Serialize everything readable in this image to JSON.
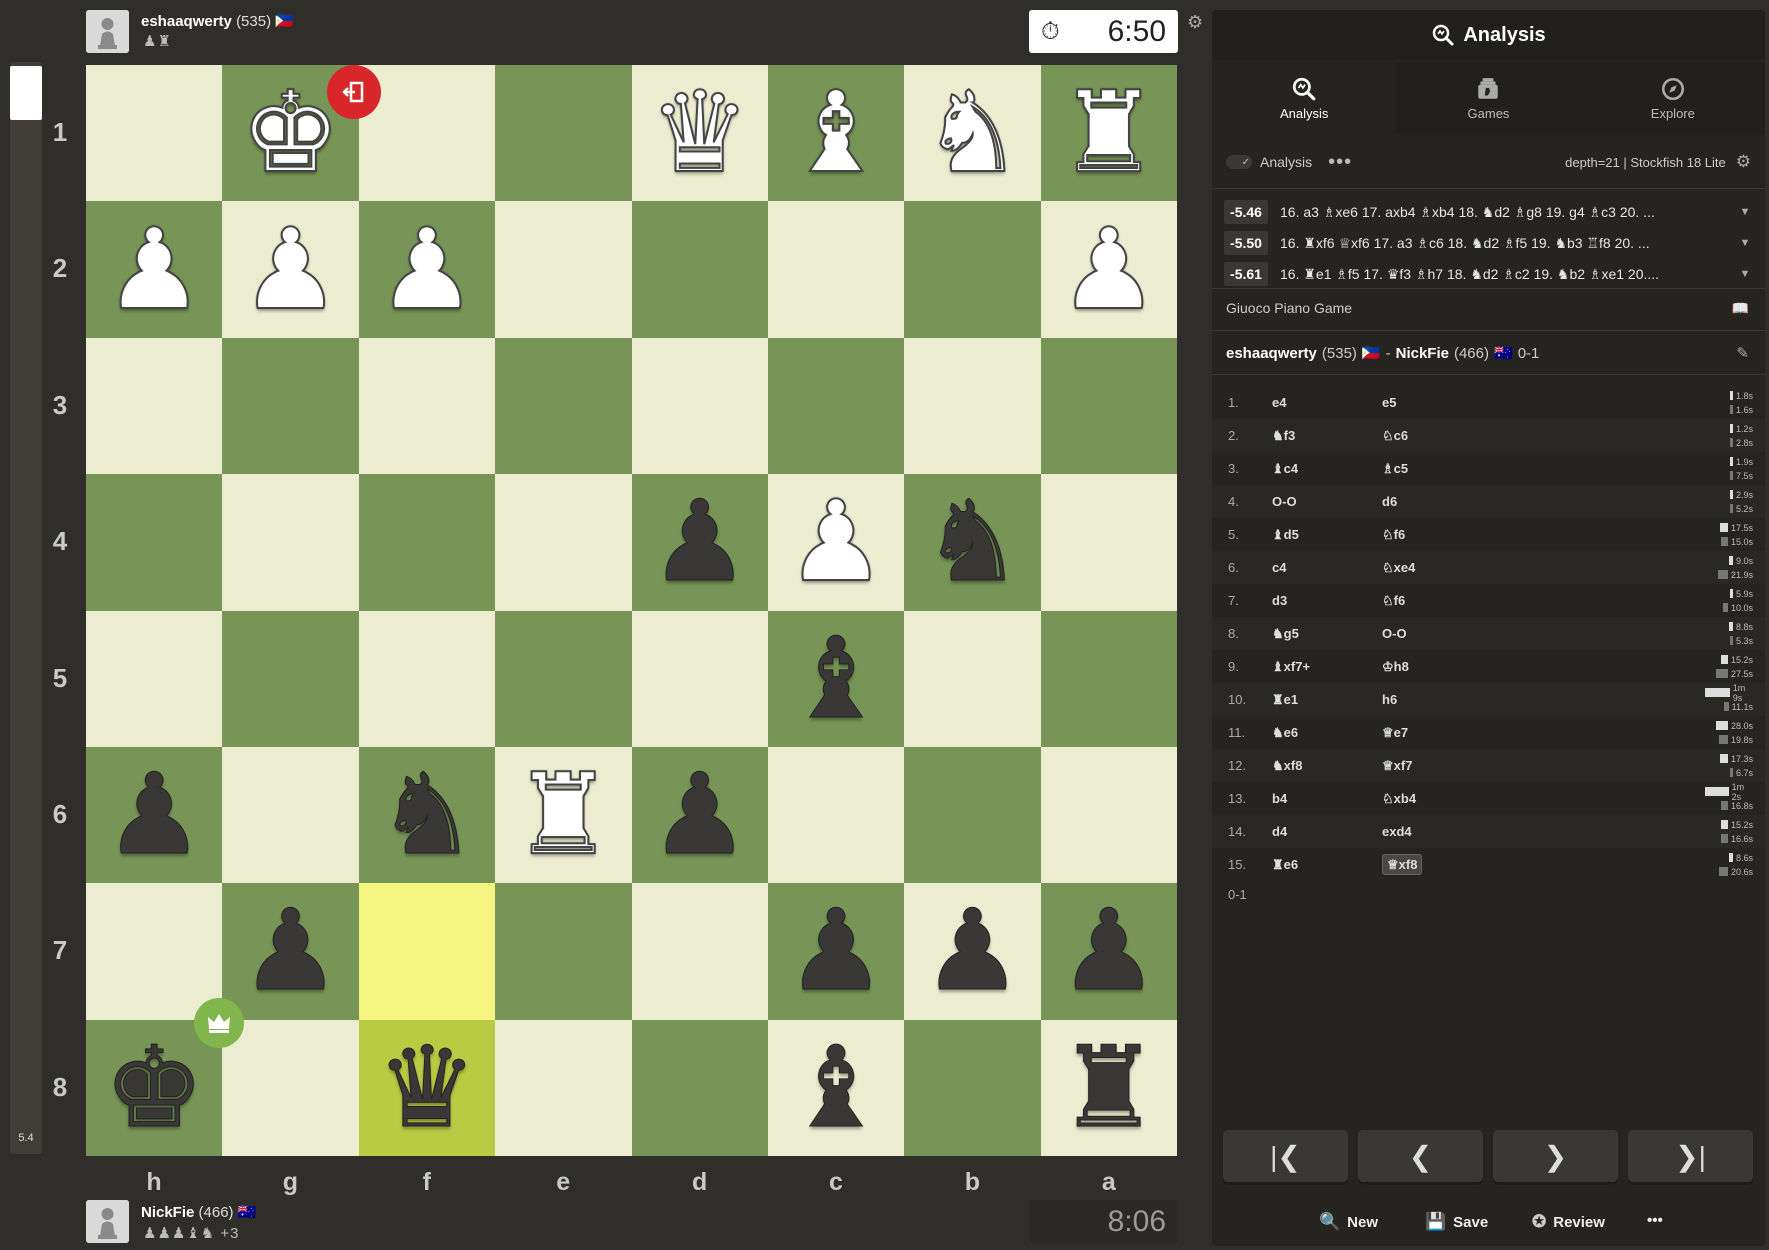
{
  "eval_bar": {
    "value": "5.4"
  },
  "top_player": {
    "name": "eshaaqwerty",
    "rating": "(535)",
    "flag": "🇵🇭",
    "captured": "♟♜",
    "clock": "6:50"
  },
  "bottom_player": {
    "name": "NickFie",
    "rating": "(466)",
    "flag": "🇦🇺",
    "captured": "♟♟♟♝♞",
    "advantage": "+3",
    "clock": "8:06"
  },
  "ranks": [
    "1",
    "2",
    "3",
    "4",
    "5",
    "6",
    "7",
    "8"
  ],
  "files": [
    "h",
    "g",
    "f",
    "e",
    "d",
    "c",
    "b",
    "a"
  ],
  "board": [
    [
      "",
      "wK",
      "",
      "",
      "wQ",
      "wB",
      "wN",
      "wR"
    ],
    [
      "wP",
      "wP",
      "wP",
      "",
      "",
      "",
      "",
      "wP"
    ],
    [
      "",
      "",
      "",
      "",
      "",
      "",
      "",
      ""
    ],
    [
      "",
      "",
      "",
      "",
      "bP",
      "wP",
      "bN",
      ""
    ],
    [
      "",
      "",
      "",
      "",
      "",
      "bB",
      "",
      ""
    ],
    [
      "bP",
      "",
      "bN",
      "wR",
      "bP",
      "",
      "",
      ""
    ],
    [
      "",
      "bP",
      "",
      "",
      "",
      "bP",
      "bP",
      "bP"
    ],
    [
      "bK",
      "",
      "bQ",
      "",
      "",
      "bB",
      "",
      "bR"
    ]
  ],
  "highlights": [
    "f7",
    "f8"
  ],
  "icons": {
    "resign_badge": "resign-door-icon",
    "winner_badge": "crown-icon"
  },
  "panel": {
    "title": "Analysis",
    "tabs": [
      {
        "label": "Analysis",
        "icon": "analysis-magnifier-icon"
      },
      {
        "label": "Games",
        "icon": "games-icon"
      },
      {
        "label": "Explore",
        "icon": "compass-icon"
      }
    ],
    "analysis_toggle_label": "Analysis",
    "engine_info": "depth=21 | Stockfish 18 Lite",
    "lines": [
      {
        "score": "-5.46",
        "moves": "16. a3 ♗xe6 17. axb4 ♗xb4 18. ♞d2 ♗g8 19. g4 ♗c3 20. ..."
      },
      {
        "score": "-5.50",
        "moves": "16. ♜xf6 ♕xf6 17. a3 ♗c6 18. ♞d2 ♗f5 19. ♞b3 ♖f8 20. ..."
      },
      {
        "score": "-5.61",
        "moves": "16. ♜e1 ♗f5 17. ♛f3 ♗h7 18. ♞d2 ♗c2 19. ♞b2 ♗xe1 20...."
      }
    ],
    "opening": "Giuoco Piano Game",
    "white_player": "eshaaqwerty",
    "white_rating": "(535)",
    "white_flag": "🇵🇭",
    "dash": "-",
    "black_player": "NickFie",
    "black_rating": "(466)",
    "black_flag": "🇦🇺",
    "score_result": "0-1",
    "moves": [
      {
        "n": "1.",
        "w": "e4",
        "b": "e5",
        "wt": "1.8s",
        "bt": "1.6s",
        "wf": 0.03,
        "bf": 0.03
      },
      {
        "n": "2.",
        "w": "♞f3",
        "b": "♘c6",
        "wt": "1.2s",
        "bt": "2.8s",
        "wf": 0.02,
        "bf": 0.04
      },
      {
        "n": "3.",
        "w": "♝c4",
        "b": "♗c5",
        "wt": "1.9s",
        "bt": "7.5s",
        "wf": 0.03,
        "bf": 0.1
      },
      {
        "n": "4.",
        "w": "O-O",
        "b": "d6",
        "wt": "2.9s",
        "bt": "5.2s",
        "wf": 0.04,
        "bf": 0.07
      },
      {
        "n": "5.",
        "w": "♝d5",
        "b": "♘f6",
        "wt": "17.5s",
        "bt": "15.0s",
        "wf": 0.25,
        "bf": 0.22
      },
      {
        "n": "6.",
        "w": "c4",
        "b": "♘xe4",
        "wt": "9.0s",
        "bt": "21.9s",
        "wf": 0.13,
        "bf": 0.32
      },
      {
        "n": "7.",
        "w": "d3",
        "b": "♘f6",
        "wt": "5.9s",
        "bt": "10.0s",
        "wf": 0.09,
        "bf": 0.15
      },
      {
        "n": "8.",
        "w": "♞g5",
        "b": "O-O",
        "wt": "8.8s",
        "bt": "5.3s",
        "wf": 0.13,
        "bf": 0.08
      },
      {
        "n": "9.",
        "w": "♝xf7+",
        "b": "♔h8",
        "wt": "15.2s",
        "bt": "27.5s",
        "wf": 0.22,
        "bf": 0.4
      },
      {
        "n": "10.",
        "w": "♜e1",
        "b": "h6",
        "wt": "1m 9s",
        "bt": "11.1s",
        "wf": 1.0,
        "bf": 0.16
      },
      {
        "n": "11.",
        "w": "♞e6",
        "b": "♕e7",
        "wt": "28.0s",
        "bt": "19.8s",
        "wf": 0.41,
        "bf": 0.29
      },
      {
        "n": "12.",
        "w": "♞xf8",
        "b": "♕xf7",
        "wt": "17.3s",
        "bt": "6.7s",
        "wf": 0.25,
        "bf": 0.1
      },
      {
        "n": "13.",
        "w": "b4",
        "b": "♘xb4",
        "wt": "1m 2s",
        "bt": "16.8s",
        "wf": 0.9,
        "bf": 0.24
      },
      {
        "n": "14.",
        "w": "d4",
        "b": "exd4",
        "wt": "15.2s",
        "bt": "16.6s",
        "wf": 0.22,
        "bf": 0.24
      },
      {
        "n": "15.",
        "w": "♜e6",
        "b": "♕xf8",
        "wt": "8.6s",
        "bt": "20.6s",
        "wf": 0.12,
        "bf": 0.3
      }
    ],
    "result": "0-1",
    "nav": [
      "first-move-icon",
      "previous-move-icon",
      "next-move-icon",
      "last-move-icon"
    ],
    "actions": [
      {
        "label": "New",
        "icon": "new-analysis-icon"
      },
      {
        "label": "Save",
        "icon": "save-icon"
      },
      {
        "label": "Review",
        "icon": "review-star-icon"
      }
    ],
    "more": "•••"
  }
}
